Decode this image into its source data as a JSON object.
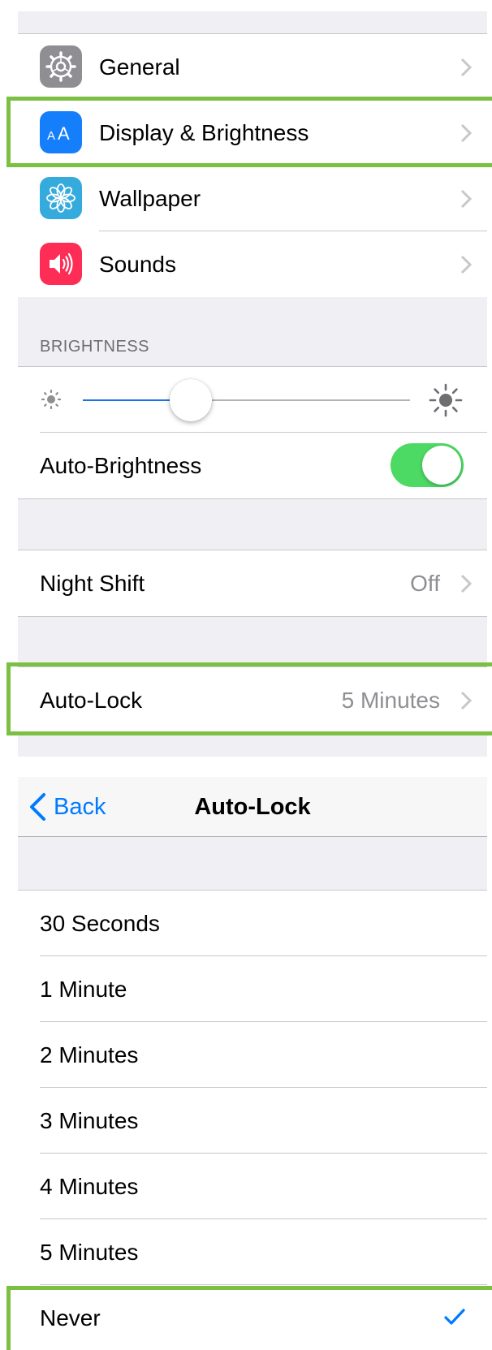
{
  "settings_list": {
    "items": [
      {
        "label": "General",
        "icon": "gear-icon",
        "icon_color": "#8e8e93"
      },
      {
        "label": "Display & Brightness",
        "icon": "text-size-icon",
        "icon_color": "#147efb"
      },
      {
        "label": "Wallpaper",
        "icon": "flower-icon",
        "icon_color": "#35aadc"
      },
      {
        "label": "Sounds",
        "icon": "speaker-icon",
        "icon_color": "#fe2d55"
      }
    ]
  },
  "brightness": {
    "header": "BRIGHTNESS",
    "slider_level": 0.33,
    "auto_brightness_label": "Auto-Brightness",
    "auto_brightness_on": true
  },
  "night_shift": {
    "label": "Night Shift",
    "value": "Off"
  },
  "auto_lock": {
    "label": "Auto-Lock",
    "value": "5 Minutes"
  },
  "auto_lock_screen": {
    "back_label": "Back",
    "title": "Auto-Lock",
    "options": [
      "30 Seconds",
      "1 Minute",
      "2 Minutes",
      "3 Minutes",
      "4 Minutes",
      "5 Minutes",
      "Never"
    ],
    "selected": "Never"
  },
  "colors": {
    "highlight": "#7cc043",
    "accent": "#007aff",
    "toggle_on": "#4cd964",
    "background": "#efeff4"
  }
}
